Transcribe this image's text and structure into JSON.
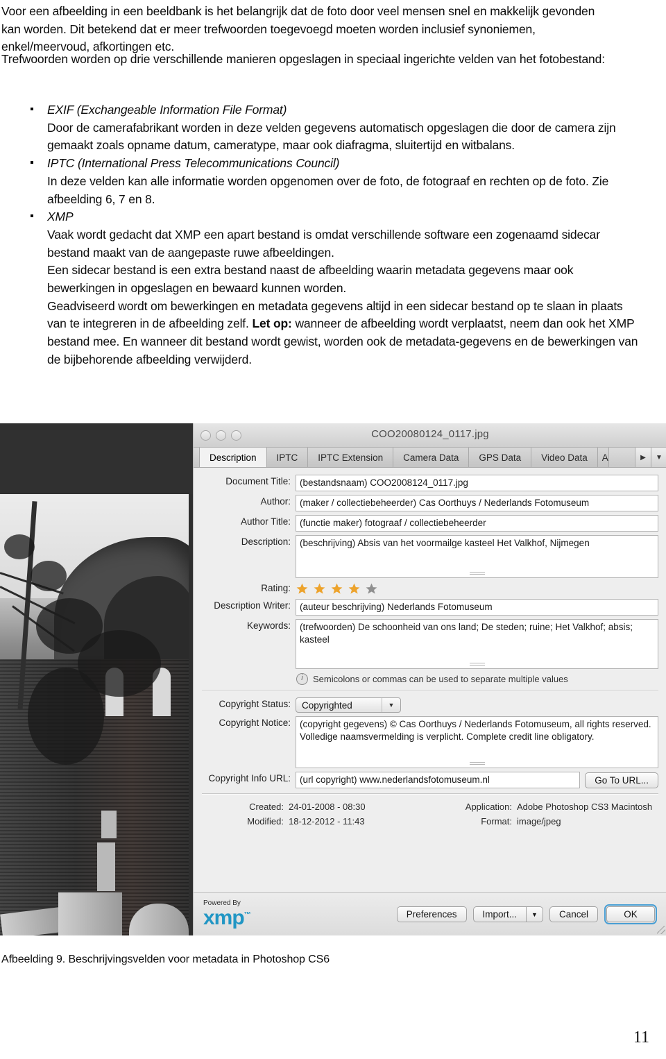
{
  "document": {
    "paragraph_1": "Voor een afbeelding in een beeldbank is het belangrijk dat de foto door veel mensen snel en makkelijk gevonden kan worden. Dit betekend dat er meer trefwoorden toegevoegd moeten worden inclusief synoniemen, enkel/meervoud, afkortingen etc.",
    "paragraph_2": "Trefwoorden worden op drie verschillende manieren opgeslagen in speciaal ingerichte velden van het fotobestand:",
    "bullets": [
      {
        "heading": "EXIF (Exchangeable Information File Format)",
        "body": "Door de camerafabrikant worden in deze velden gegevens automatisch opgeslagen die door de camera zijn gemaakt zoals opname datum, cameratype, maar ook diafragma, sluitertijd en witbalans."
      },
      {
        "heading": "IPTC (International Press Telecommunications Council)",
        "body": "In deze velden kan alle informatie worden opgenomen over de foto, de fotograaf en rechten op de foto. Zie afbeelding 6, 7 en 8."
      },
      {
        "heading": "XMP",
        "body_part_1": "Vaak wordt gedacht dat XMP een apart bestand is omdat verschillende software een zogenaamd sidecar bestand maakt van de aangepaste ruwe afbeeldingen.",
        "body_part_2": "Een sidecar bestand is een extra bestand naast de afbeelding waarin metadata gegevens maar ook bewerkingen in opgeslagen en bewaard kunnen worden.",
        "body_part_3a": "Geadviseerd wordt om bewerkingen en metadata gegevens altijd in een sidecar bestand op te slaan in plaats van te integreren in de afbeelding zelf. ",
        "body_bold": "Let op:",
        "body_part_3b": " wanneer de afbeelding wordt verplaatst, neem dan ook het XMP bestand mee. En wanneer dit bestand wordt gewist, worden ook de metadata-gegevens en de bewerkingen van de bijbehorende afbeelding verwijderd."
      }
    ],
    "figure_caption": "Afbeelding 9. Beschrijvingsvelden voor metadata in Photoshop CS6",
    "page_number": "11"
  },
  "screenshot": {
    "window_title": "COO20080124_0117.jpg",
    "tabs": [
      {
        "label": "Description",
        "active": true
      },
      {
        "label": "IPTC",
        "active": false
      },
      {
        "label": "IPTC Extension",
        "active": false
      },
      {
        "label": "Camera Data",
        "active": false
      },
      {
        "label": "GPS Data",
        "active": false
      },
      {
        "label": "Video Data",
        "active": false
      },
      {
        "label": "A",
        "active": false
      }
    ],
    "tab_nav": {
      "next_label": "▶",
      "menu_label": "▼"
    },
    "fields": {
      "document_title": {
        "label": "Document Title:",
        "value": "(bestandsnaam) COO2008124_0117.jpg"
      },
      "author": {
        "label": "Author:",
        "value": "(maker / collectiebeheerder) Cas Oorthuys / Nederlands Fotomuseum"
      },
      "author_title": {
        "label": "Author Title:",
        "value": "(functie maker) fotograaf / collectiebeheerder"
      },
      "description": {
        "label": "Description:",
        "value": "(beschrijving) Absis van het voormailge kasteel Het Valkhof, Nijmegen"
      },
      "rating": {
        "label": "Rating:",
        "value": 4,
        "max": 5,
        "filled_color": "#eda32c",
        "empty_color": "#8f8f8f"
      },
      "description_writer": {
        "label": "Description Writer:",
        "value": "(auteur beschrijving) Nederlands Fotomuseum"
      },
      "keywords": {
        "label": "Keywords:",
        "value": "(trefwoorden) De schoonheid van ons land; De steden; ruine; Het Valkhof; absis; kasteel"
      },
      "keywords_hint": "Semicolons or commas can be used to separate multiple values",
      "copyright_status": {
        "label": "Copyright Status:",
        "value": "Copyrighted"
      },
      "copyright_notice": {
        "label": "Copyright Notice:",
        "line1": "(copyright gegevens) © Cas Oorthuys / Nederlands Fotomuseum, all rights reserved.",
        "line2": "Volledige naamsvermelding is verplicht. Complete credit line obligatory."
      },
      "copyright_info_url": {
        "label": "Copyright Info URL:",
        "value": "(url copyright) www.nederlandsfotomuseum.nl",
        "button": "Go To URL..."
      }
    },
    "meta": {
      "created": {
        "label": "Created:",
        "value": "24-01-2008 - 08:30"
      },
      "modified": {
        "label": "Modified:",
        "value": "18-12-2012 - 11:43"
      },
      "application": {
        "label": "Application:",
        "value": "Adobe Photoshop CS3 Macintosh"
      },
      "format": {
        "label": "Format:",
        "value": "image/jpeg"
      }
    },
    "footer": {
      "powered_by": "Powered By",
      "xmp": "xmp",
      "xmp_tm": "™",
      "preferences": "Preferences",
      "import": "Import...",
      "import_arrow": "▼",
      "cancel": "Cancel",
      "ok": "OK",
      "ok_accent": "#4a9fd4"
    }
  }
}
